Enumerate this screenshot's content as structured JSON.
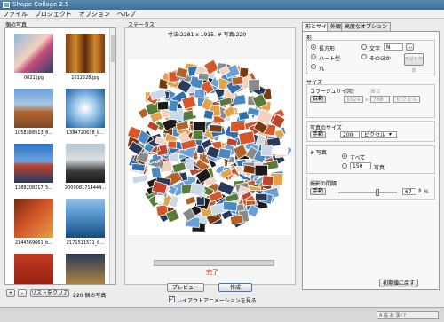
{
  "window": {
    "title": "Shape Collage 2.5"
  },
  "menu": [
    "ファイル",
    "プロジェクト",
    "オプション",
    "ヘルプ"
  ],
  "photos": {
    "title": "個の写真",
    "items": [
      {
        "name": "0021.jpg"
      },
      {
        "name": "1012628.jpg"
      },
      {
        "name": "1058388513_8..."
      },
      {
        "name": "1384720638_b..."
      },
      {
        "name": "1388208217_5..."
      },
      {
        "name": "2009081714444..."
      },
      {
        "name": "2144569661_b..."
      },
      {
        "name": "2171511571_6..."
      }
    ],
    "add_label": "+",
    "remove_label": "-",
    "clear_label": "リストをクリア",
    "count_text": "220 個の写真"
  },
  "status": {
    "title": "ステータス",
    "info": "寸法:2281 x 1915. # 写真:220",
    "progress_value": 1.0,
    "done_text": "完了",
    "preview_label": "プレビュー",
    "create_label": "作成",
    "animate_label": "レイアウトアニメーションを見る"
  },
  "tabs": [
    "形とサイズ",
    "外観",
    "高度なオプション"
  ],
  "shape": {
    "title": "形",
    "options": [
      "長方形",
      "ハート型",
      "丸",
      "文字",
      "そのほか"
    ],
    "text_value": "N",
    "more_label": "...",
    "create_shape_label": "形状を作成"
  },
  "size": {
    "title": "サイズ",
    "collage_size_label": "コラージュサイズ",
    "auto_label": "自動",
    "width_label": "横幅",
    "height_label": "高さ",
    "width_value": "1024",
    "height_value": "768",
    "unit_value": "ピクセル",
    "photo_size_label": "写真のサイズ",
    "manual_label": "手動",
    "photo_size_value": "200",
    "photo_unit": "ピクセル"
  },
  "count": {
    "title": "# 写真",
    "all_label": "すべて",
    "num_value": "150",
    "photos_suffix": "写真"
  },
  "spacing": {
    "title": "撮影の間隔",
    "manual_label": "手動",
    "value": "67",
    "unit": "%",
    "level": 0.67
  },
  "reset_label": "初期値に戻す",
  "colors": {
    "accent": "#1c63b7",
    "done": "#cc2200",
    "title_bar": "#4a7aa0"
  }
}
